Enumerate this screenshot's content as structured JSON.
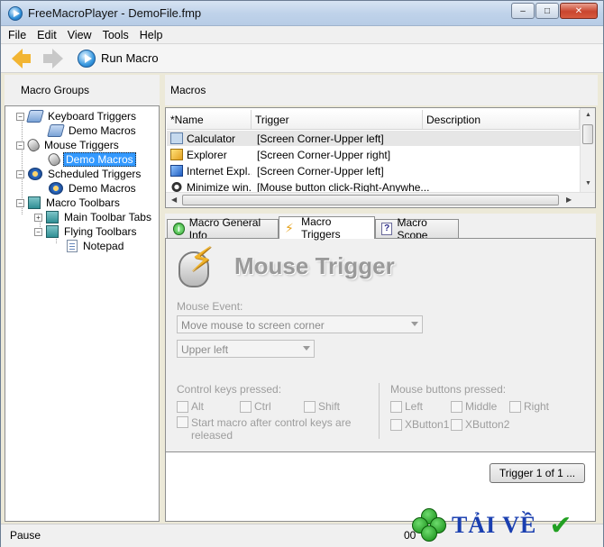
{
  "window": {
    "title": "FreeMacroPlayer - DemoFile.fmp",
    "controls": {
      "minimize": "–",
      "maximize": "□",
      "close": "✕"
    }
  },
  "menu": [
    "File",
    "Edit",
    "View",
    "Tools",
    "Help"
  ],
  "toolbar": {
    "back_icon": "back-arrow-icon",
    "forward_icon": "forward-arrow-icon",
    "run_label": "Run Macro"
  },
  "left_panel": {
    "title": "Macro Groups",
    "tree": [
      {
        "label": "Keyboard Triggers",
        "icon": "keyboard-icon",
        "toggle": "−"
      },
      {
        "label": "Demo Macros",
        "icon": "keyboard-icon"
      },
      {
        "label": "Mouse Triggers",
        "icon": "mouse-icon",
        "toggle": "−"
      },
      {
        "label": "Demo Macros",
        "icon": "mouse-icon",
        "selected": true
      },
      {
        "label": "Scheduled Triggers",
        "icon": "schedule-icon",
        "toggle": "−"
      },
      {
        "label": "Demo Macros",
        "icon": "schedule-icon"
      },
      {
        "label": "Macro Toolbars",
        "icon": "toolbar-icon",
        "toggle": "−"
      },
      {
        "label": "Main Toolbar Tabs",
        "icon": "toolbar-icon",
        "toggle": "+"
      },
      {
        "label": "Flying Toolbars",
        "icon": "toolbar-icon",
        "toggle": "−"
      },
      {
        "label": "Notepad",
        "icon": "page-icon"
      }
    ]
  },
  "macros": {
    "title": "Macros",
    "columns": [
      "*Name",
      "Trigger",
      "Description"
    ],
    "rows": [
      {
        "name": "Calculator",
        "trigger": "[Screen Corner-Upper left]",
        "icon": "calculator-icon"
      },
      {
        "name": "Explorer",
        "trigger": "[Screen Corner-Upper right]",
        "icon": "explorer-icon"
      },
      {
        "name": "Internet Expl...",
        "trigger": "[Screen Corner-Upper left]",
        "icon": "internet-explorer-icon"
      },
      {
        "name": "Minimize win...",
        "trigger": "[Mouse button click-Right-Anywhe...",
        "icon": "minimize-icon"
      }
    ]
  },
  "tabs": {
    "items": [
      "Macro General Info",
      "Macro Triggers",
      "Macro Scope"
    ],
    "active": "Macro Triggers"
  },
  "trigger_panel": {
    "heading": "Mouse Trigger",
    "mouse_event_label": "Mouse Event:",
    "mouse_event_value": "Move mouse to screen corner",
    "corner_value": "Upper left",
    "control_keys_label": "Control keys pressed:",
    "control_keys": [
      "Alt",
      "Ctrl",
      "Shift"
    ],
    "start_after_label_1": "Start macro after control keys are",
    "start_after_label_2": "released",
    "mouse_buttons_label": "Mouse buttons pressed:",
    "mouse_buttons_row1": [
      "Left",
      "Middle",
      "Right"
    ],
    "mouse_buttons_row2": [
      "XButton1",
      "XButton2"
    ],
    "trigger_button": "Trigger 1 of 1 ..."
  },
  "status": {
    "left": "Pause",
    "right": "00"
  },
  "watermark": {
    "text": "TẢI VỀ"
  },
  "colors": {
    "selection": "#3399ff",
    "row_highlight": "#e6e6e6",
    "watermark_text": "#1a3fb0",
    "check": "#22a022"
  }
}
